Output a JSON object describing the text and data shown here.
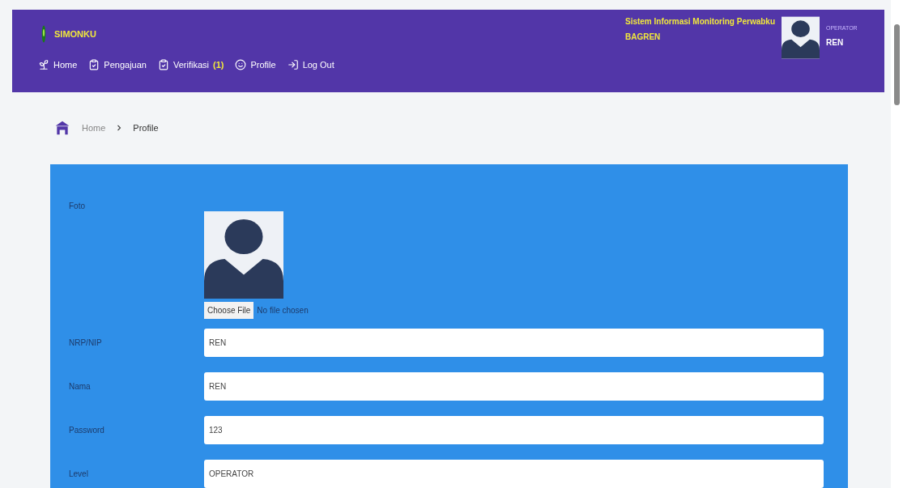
{
  "header": {
    "app_name": "SIMONKU",
    "system_title": "Sistem Informasi Monitoring Perwabku",
    "unit": "BAGREN",
    "user_role": "OPERATOR",
    "user_name": "REN"
  },
  "nav": [
    {
      "kind": "home",
      "label": "Home"
    },
    {
      "kind": "check",
      "label": "Pengajuan"
    },
    {
      "kind": "check",
      "label": "Verifikasi",
      "badge": "(1)"
    },
    {
      "kind": "profile",
      "label": "Profile"
    },
    {
      "kind": "logout",
      "label": "Log Out"
    }
  ],
  "breadcrumb": [
    "Home",
    "Profile"
  ],
  "form": {
    "photo_label": "Foto",
    "file_button": "Choose File",
    "file_status": "No file chosen",
    "fields": [
      {
        "label": "NRP/NIP",
        "value": "REN"
      },
      {
        "label": "Nama",
        "value": "REN"
      },
      {
        "label": "Password",
        "value": "123"
      },
      {
        "label": "Level",
        "value": "OPERATOR"
      }
    ]
  }
}
